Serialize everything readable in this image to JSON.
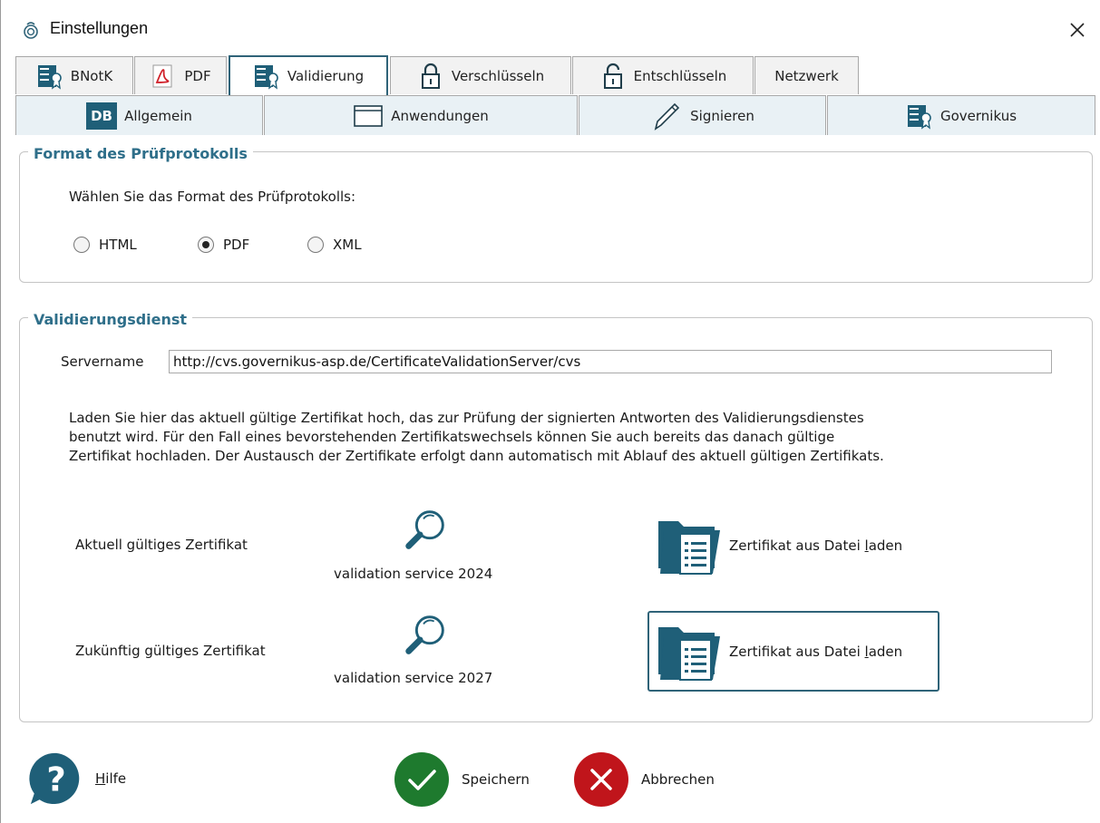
{
  "window": {
    "title": "Einstellungen"
  },
  "tabs_row1": [
    {
      "label": "BNotK",
      "icon": "server-certificate-icon"
    },
    {
      "label": "PDF",
      "icon": "pdf-icon"
    },
    {
      "label": "Validierung",
      "icon": "server-certificate-icon",
      "active": true
    },
    {
      "label": "Verschlüsseln",
      "icon": "lock-closed-icon"
    },
    {
      "label": "Entschlüsseln",
      "icon": "lock-open-icon"
    },
    {
      "label": "Netzwerk",
      "icon": ""
    }
  ],
  "tabs_row2": [
    {
      "label": "Allgemein",
      "icon": "db-icon",
      "icon_text": "DB"
    },
    {
      "label": "Anwendungen",
      "icon": "window-icon"
    },
    {
      "label": "Signieren",
      "icon": "pen-icon"
    },
    {
      "label": "Governikus",
      "icon": "server-certificate-icon"
    }
  ],
  "format_section": {
    "legend": "Format des Prüfprotokolls",
    "prompt": "Wählen Sie das Format des Prüfprotokolls:",
    "options": [
      "HTML",
      "PDF",
      "XML"
    ],
    "selected": "PDF"
  },
  "validation_section": {
    "legend": "Validierungsdienst",
    "server_label": "Servername",
    "server_value": "http://cvs.governikus-asp.de/CertificateValidationServer/cvs",
    "description_lines": [
      "Laden Sie hier das aktuell gültige Zertifikat hoch, das zur Prüfung der signierten Antworten des Validierungsdienstes",
      "benutzt wird. Für den Fall eines bevorstehenden Zertifikatswechsels können Sie auch bereits das danach gültige",
      "Zertifikat hochladen. Der Austausch der Zertifikate erfolgt dann automatisch mit Ablauf des aktuell gültigen Zertifikats."
    ],
    "current": {
      "label": "Aktuell gültiges Zertifikat",
      "cert_name": "validation service 2024",
      "load_label_pre": "Zertifikat aus Datei ",
      "load_label_mnemonic": "l",
      "load_label_post": "aden"
    },
    "future": {
      "label": "Zukünftig gültiges Zertifikat",
      "cert_name": "validation service 2027",
      "load_label_pre": "Zertifikat aus Datei ",
      "load_label_mnemonic": "l",
      "load_label_post": "aden"
    }
  },
  "footer": {
    "help_mnemonic": "H",
    "help_rest": "ilfe",
    "save": "Speichern",
    "cancel": "Abbrechen"
  },
  "colors": {
    "accent": "#2f6378",
    "legend": "#2f6f8a",
    "icon_teal": "#1f5f78",
    "save_green": "#1e7a2e",
    "cancel_red": "#c0151b"
  }
}
